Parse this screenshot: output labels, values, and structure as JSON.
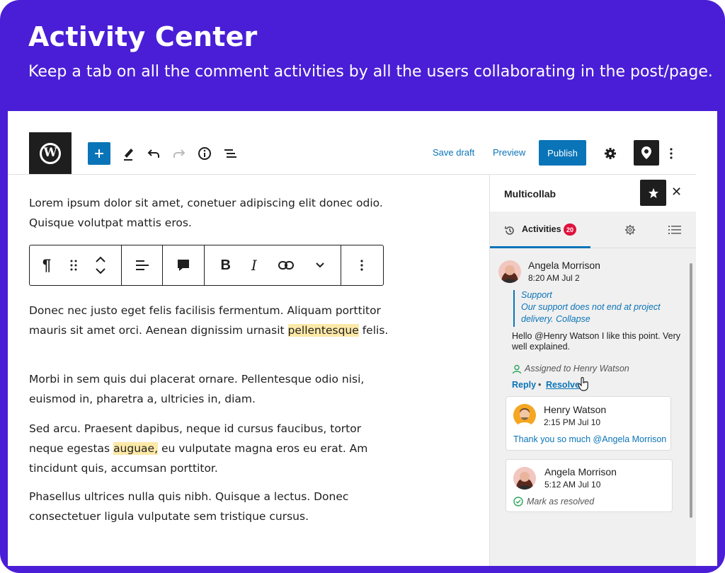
{
  "hero": {
    "title": "Activity Center",
    "subtitle": "Keep a tab on all the comment activities by all the users collaborating in the post/page."
  },
  "toolbar": {
    "save_draft": "Save draft",
    "preview": "Preview",
    "publish": "Publish",
    "icons": [
      "wordpress-logo",
      "plus-icon",
      "pen-icon",
      "undo-icon",
      "redo-icon",
      "info-icon",
      "list-view-icon",
      "gear-icon",
      "multicollab-icon",
      "more-vertical-icon"
    ]
  },
  "editor": {
    "p1": "Lorem ipsum dolor sit amet, conetuer adipiscing elit donec odio. Quisque volutpat mattis eros.",
    "p2_before": "Donec nec justo eget felis facilisis fermentum. Aliquam porttitor mauris sit amet orci. Aenean dignissim urnasit ",
    "p2_highlight": "pellentesque",
    "p2_after": " felis.",
    "p3": "Morbi in sem quis dui placerat ornare. Pellentesque odio nisi, euismod in, pharetra a, ultricies in, diam.",
    "p4_before": "Sed arcu. Praesent dapibus, neque id cursus faucibus, tortor neque egestas ",
    "p4_highlight": "auguae,",
    "p4_after": " eu vulputate magna eros eu erat. Am tincidunt quis, accumsan porttitor.",
    "p5": "Phasellus ultrices nulla quis nibh. Quisque a lectus. Donec consectetuer ligula vulputate sem tristique cursus."
  },
  "sidebar": {
    "title": "Multicollab",
    "tabs": {
      "activities_label": "Activities",
      "activities_count": "20"
    },
    "thread": {
      "author": "Angela Morrison",
      "time": "8:20 AM Jul 2",
      "quote_line1": "Support",
      "quote_line2": "Our support does not end at project",
      "quote_line3": "delivery. Collapse",
      "message": "Hello @Henry Watson I like this point. Very well explained.",
      "assigned": "Assigned to Henry Watson",
      "reply": "Reply",
      "separator": "•",
      "resolve": "Resolve"
    },
    "reply_card": {
      "author": "Henry Watson",
      "time": "2:15 PM Jul 10",
      "message": "Thank you so much @Angela Morrison"
    },
    "resolved_card": {
      "author": "Angela Morrison",
      "time": "5:12 AM Jul 10",
      "status": "Mark as resolved"
    }
  },
  "colors": {
    "brand": "#4a1ed6",
    "accent": "#0a74b8",
    "badge": "#e0123d",
    "highlight": "#fde9a8"
  }
}
